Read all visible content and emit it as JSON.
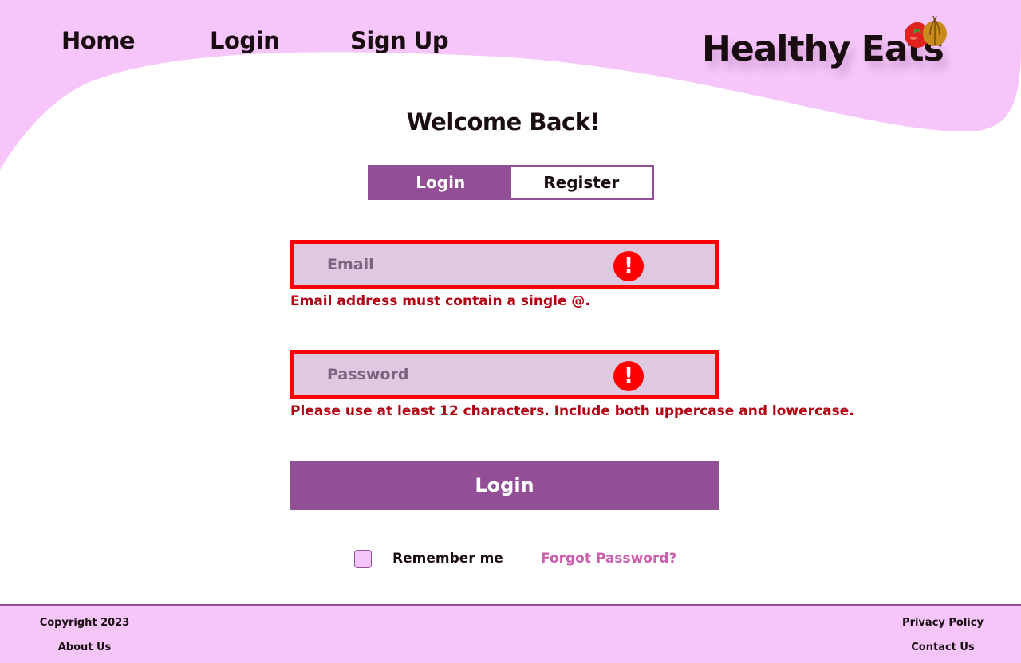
{
  "nav": {
    "home": "Home",
    "login": "Login",
    "signup": "Sign Up"
  },
  "brand": {
    "logo_text": "Healthy Eats",
    "accent": "#f6c6fb",
    "primary": "#924f96",
    "error": "#ff0000",
    "link": "#cc5fae"
  },
  "page": {
    "title": "Welcome Back!"
  },
  "tabs": {
    "login": "Login",
    "register": "Register",
    "active": "login"
  },
  "form": {
    "email": {
      "placeholder": "Email",
      "value": "",
      "error": "Email address must contain a single @.",
      "icon": "error-icon"
    },
    "password": {
      "placeholder": "Password",
      "value": "",
      "error": "Please use at least 12 characters. Include both uppercase and lowercase.",
      "icon": "error-icon"
    },
    "submit_label": "Login",
    "remember_label": "Remember me",
    "remember_checked": false,
    "forgot_label": "Forgot Password?"
  },
  "footer": {
    "copyright": "Copyright 2023",
    "about": "About Us",
    "privacy": "Privacy Policy",
    "contact": "Contact Us"
  }
}
